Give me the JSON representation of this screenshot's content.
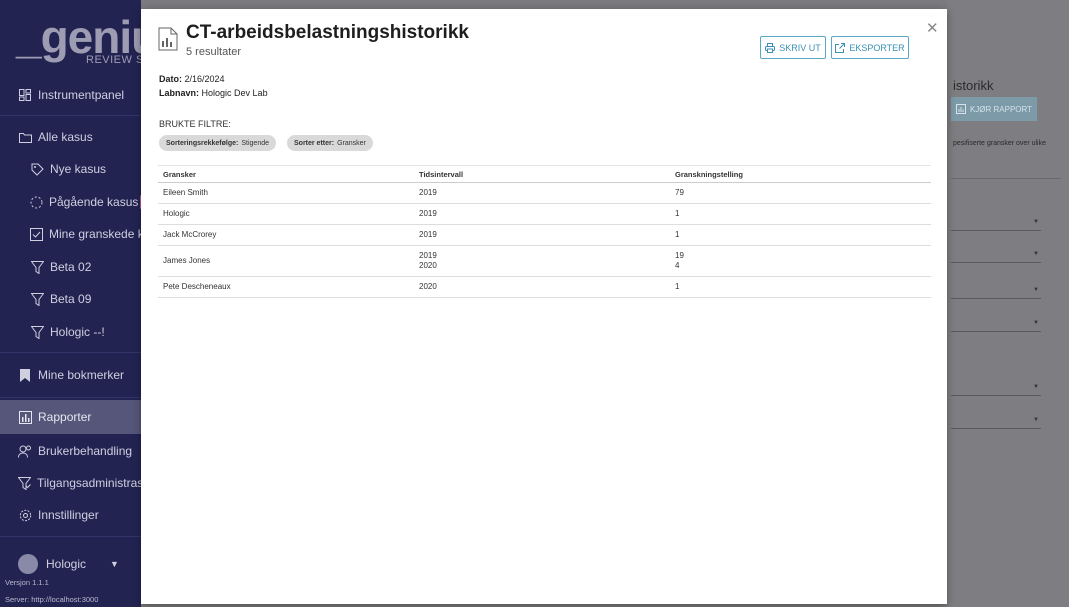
{
  "sidebar": {
    "logo_word": "_genius",
    "logo_sub": "REVIEW STATIO",
    "items": [
      {
        "label": "Instrumentpanel",
        "icon": "dashboard-icon"
      },
      {
        "label": "Alle kasus",
        "icon": "folder-icon"
      },
      {
        "label": "Nye kasus",
        "icon": "new-tag-icon"
      },
      {
        "label": "Pågående kasus",
        "icon": "in-progress-icon"
      },
      {
        "label": "Mine granskede ka",
        "icon": "checkbox-icon"
      },
      {
        "label": "Beta 02",
        "icon": "filter-icon"
      },
      {
        "label": "Beta 09",
        "icon": "filter-icon"
      },
      {
        "label": "Hologic --!",
        "icon": "filter-icon"
      },
      {
        "label": "Mine bokmerker",
        "icon": "bookmark-icon"
      },
      {
        "label": "Rapporter",
        "icon": "report-icon"
      },
      {
        "label": "Brukerbehandling",
        "icon": "users-icon"
      },
      {
        "label": "Tilgangsadministrasjo",
        "icon": "access-icon"
      },
      {
        "label": "Innstillinger",
        "icon": "gear-icon"
      }
    ],
    "user_name": "Hologic",
    "version": "Versjon 1.1.1",
    "server": "Server: http://localhost:3000"
  },
  "background": {
    "title": "istorikk",
    "run_button": "KJØR RAPPORT",
    "description": "pesifiserte gransker over ulike"
  },
  "modal": {
    "title": "CT-arbeidsbelastningshistorikk",
    "subtitle": "5 resultater",
    "print_label": "SKRIV UT",
    "export_label": "EKSPORTER",
    "date_label": "Dato:",
    "date_value": "2/16/2024",
    "lab_label": "Labnavn:",
    "lab_value": "Hologic Dev Lab",
    "filters_heading": "BRUKTE FILTRE:",
    "chips": [
      {
        "label": "Sorteringsrekkefølge:",
        "value": "Stigende"
      },
      {
        "label": "Sorter etter:",
        "value": "Gransker"
      }
    ],
    "table": {
      "columns": [
        "Gransker",
        "Tidsintervall",
        "Granskningstelling"
      ],
      "rows": [
        {
          "reviewer": "Eileen Smith",
          "periods": [
            "2019"
          ],
          "counts": [
            "79"
          ]
        },
        {
          "reviewer": "Hologic",
          "periods": [
            "2019"
          ],
          "counts": [
            "1"
          ]
        },
        {
          "reviewer": "Jack McCrorey",
          "periods": [
            "2019"
          ],
          "counts": [
            "1"
          ]
        },
        {
          "reviewer": "James Jones",
          "periods": [
            "2019",
            "2020"
          ],
          "counts": [
            "19",
            "4"
          ]
        },
        {
          "reviewer": "Pete Descheneaux",
          "periods": [
            "2020"
          ],
          "counts": [
            "1"
          ]
        }
      ]
    }
  }
}
